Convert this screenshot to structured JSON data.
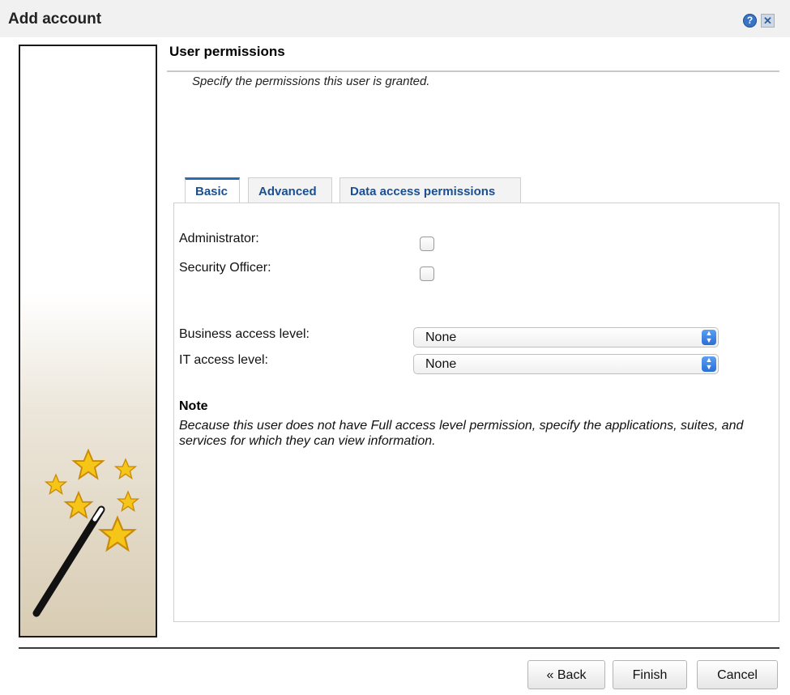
{
  "window": {
    "title": "Add account",
    "help_icon": "help-icon",
    "close_icon": "close-icon"
  },
  "section": {
    "heading": "User permissions",
    "subtitle": "Specify the permissions this user is granted."
  },
  "tabs": [
    {
      "label": "Basic",
      "active": true
    },
    {
      "label": "Advanced",
      "active": false
    },
    {
      "label": "Data access permissions",
      "active": false
    }
  ],
  "form": {
    "administrator_label": "Administrator:",
    "administrator_checked": false,
    "security_officer_label": "Security Officer:",
    "security_officer_checked": false,
    "business_access_label": "Business access level:",
    "business_access_value": "None",
    "it_access_label": "IT access level:",
    "it_access_value": "None"
  },
  "note": {
    "title": "Note",
    "text": "Because this user does not have Full access level permission, specify the applications, suites, and services for which they can view information."
  },
  "buttons": {
    "back": "« Back",
    "finish": "Finish",
    "cancel": "Cancel"
  },
  "colors": {
    "tab_text": "#1a4f91",
    "tab_active_accent": "#2b6cb0",
    "star": "#f5c518",
    "select_arrow": "#2a6fd6"
  }
}
